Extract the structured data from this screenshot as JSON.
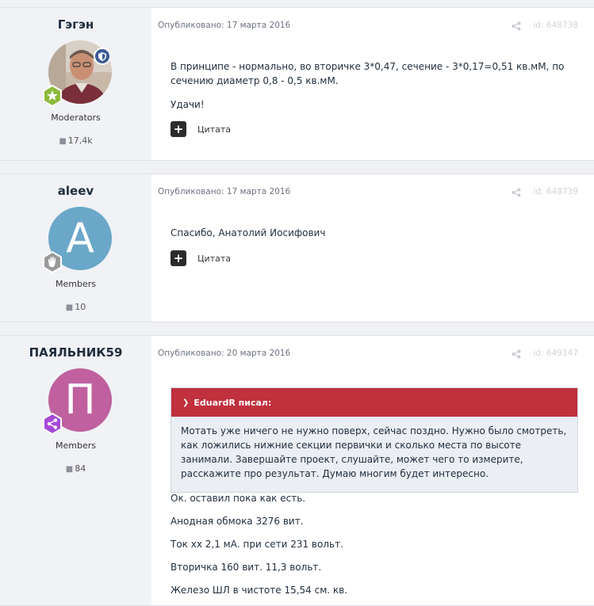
{
  "posts": [
    {
      "author": "Гэгэн",
      "group": "Moderators",
      "count": "17,4k",
      "meta": "Опубликовано: 17 марта 2016",
      "id": "id: 648738",
      "paragraphs": [
        "В принципе - нормально, во вторичке 3*0,47, сечение - 3*0,17=0,51 кв.мМ, по сечению диаметр 0,8 - 0,5 кв.мМ.",
        "Удачи!"
      ],
      "quote_label": "Цитата"
    },
    {
      "author": "aleev",
      "avatar_letter": "A",
      "group": "Members",
      "count": "10",
      "meta": "Опубликовано: 17 марта 2016",
      "id": "id: 648739",
      "paragraphs": [
        "Спасибо, Анатолий Иосифович"
      ],
      "quote_label": "Цитата"
    },
    {
      "author": "ПАЯЛЬНИК59",
      "avatar_letter": "П",
      "group": "Members",
      "count": "84",
      "meta": "Опубликовано: 20 марта 2016",
      "id": "id: 649147",
      "quote": {
        "header": "EduardR писал:",
        "text": "Мотать уже ничего не нужно поверх, сейчас поздно. Нужно было смотреть, как ложились нижние секции первички и сколько места по высоте занимали. Завершайте проект, слушайте, может чего то измерите, расскажите про результат. Думаю многим будет интересно."
      },
      "paragraphs": [
        "Ок. оставил пока как есть.",
        "Анодная обмока 3276 вит.",
        "Ток хх 2,1 мА. при сети 231 вольт.",
        "Вторичка 160 вит. 11,3 вольт.",
        "Железо ШЛ в чистоте 15,54 см. кв."
      ]
    }
  ],
  "colors": {
    "author_panel": "#f0f2f5",
    "avatar_aleev": "#6aa7c8",
    "avatar_payalnik": "#c0609f",
    "quote_header": "#c0303d",
    "quote_body": "#ebeef3"
  }
}
